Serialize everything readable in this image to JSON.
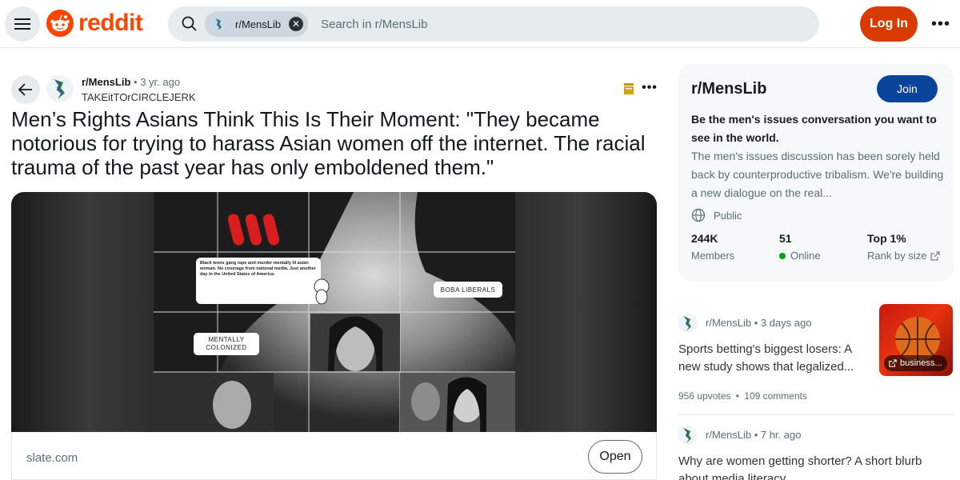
{
  "header": {
    "logo_text": "reddit",
    "search_chip_label": "r/MensLib",
    "search_placeholder": "Search in r/MensLib",
    "login_label": "Log In",
    "more_label": "•••"
  },
  "post": {
    "subreddit": "r/MensLib",
    "separator": " • ",
    "time_ago": "3 yr. ago",
    "author": "TAKEitTOrCIRCLEJERK",
    "title": "Men’s Rights Asians Think This Is Their Moment: \"They became notorious for trying to harass Asian women off the internet. The racial trauma of the past year has only emboldened them.\"",
    "more_label": "•••",
    "source_domain": "slate.com",
    "open_label": "Open",
    "media_overlays": {
      "tweet_text": "Black teens gang rape and murder mentally ill asian woman. No coverage from national media. Just another day in the United States of America.",
      "label_boba": "BOBA LIBERALS",
      "label_mentally": "MENTALLY COLONIZED"
    }
  },
  "sidebar": {
    "name": "r/MensLib",
    "join_label": "Join",
    "headline": "Be the men's issues conversation you want to see in the world.",
    "description": "The men's issues discussion has been sorely held back by counterproductive tribalism. We're building a new dialogue on the real...",
    "visibility": "Public",
    "stats": [
      {
        "value": "244K",
        "label": "Members"
      },
      {
        "value": "51",
        "label": "Online"
      },
      {
        "value": "Top 1%",
        "label": "Rank by size"
      }
    ]
  },
  "related": [
    {
      "subreddit": "r/MensLib",
      "time_ago": "3 days ago",
      "title": "Sports betting's biggest losers: A new study shows that legalized...",
      "upvotes": "956 upvotes",
      "comments": "109 comments",
      "thumb_label": "business..."
    },
    {
      "subreddit": "r/MensLib",
      "time_ago": "7 hr. ago",
      "title": "Why are women getting shorter? A short blurb about media literacy"
    }
  ],
  "colors": {
    "brand": "#ff4500",
    "login": "#d93a00",
    "join": "#0a449b",
    "online": "#01a816"
  },
  "icons": [
    "hamburger-menu-icon",
    "reddit-logo-icon",
    "search-icon",
    "close-icon",
    "back-arrow-icon",
    "flag-icon",
    "globe-icon",
    "external-link-icon"
  ]
}
